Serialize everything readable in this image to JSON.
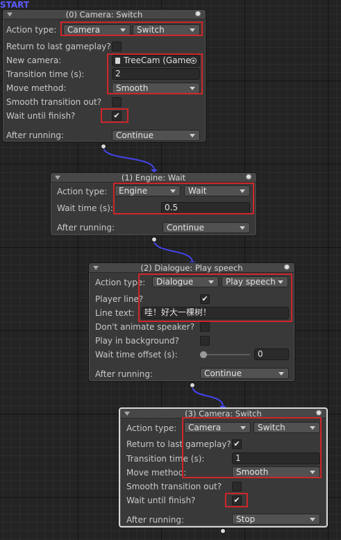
{
  "start_label": "START",
  "nodes": [
    {
      "title": "(0) Camera: Switch",
      "action_type_label": "Action type:",
      "category": "Camera",
      "action": "Switch",
      "return_label": "Return to last gameplay?",
      "return_checked": false,
      "new_camera_label": "New camera:",
      "new_camera_value": "TreeCam (Game",
      "transition_label": "Transition time (s):",
      "transition_value": "2",
      "move_method_label": "Move method:",
      "move_method_value": "Smooth",
      "smooth_out_label": "Smooth transition out?",
      "smooth_out_checked": false,
      "wait_finish_label": "Wait until finish?",
      "wait_finish_checked": true,
      "after_running_label": "After running:",
      "after_running_value": "Continue"
    },
    {
      "title": "(1) Engine: Wait",
      "action_type_label": "Action type:",
      "category": "Engine",
      "action": "Wait",
      "wait_time_label": "Wait time (s):",
      "wait_time_value": "0.5",
      "after_running_label": "After running:",
      "after_running_value": "Continue"
    },
    {
      "title": "(2) Dialogue: Play speech",
      "action_type_label": "Action type:",
      "category": "Dialogue",
      "action": "Play speech",
      "player_line_label": "Player line?",
      "player_line_checked": true,
      "line_text_label": "Line text:",
      "line_text_value": "哇！好大一棵树！",
      "dont_animate_label": "Don't animate speaker?",
      "dont_animate_checked": false,
      "play_bg_label": "Play in background?",
      "play_bg_checked": false,
      "wait_offset_label": "Wait time offset (s):",
      "wait_offset_value": "0",
      "after_running_label": "After running:",
      "after_running_value": "Continue"
    },
    {
      "title": "(3) Camera: Switch",
      "action_type_label": "Action type:",
      "category": "Camera",
      "action": "Switch",
      "return_label": "Return to last gameplay?",
      "return_checked": true,
      "transition_label": "Transition time (s):",
      "transition_value": "1",
      "move_method_label": "Move method:",
      "move_method_value": "Smooth",
      "smooth_out_label": "Smooth transition out?",
      "smooth_out_checked": false,
      "wait_finish_label": "Wait until finish?",
      "wait_finish_checked": true,
      "after_running_label": "After running:",
      "after_running_value": "Stop"
    }
  ],
  "colors": {
    "start": "#5a5bff",
    "wire": "#4444ee",
    "highlight": "#d0262b",
    "canvas": "#232323",
    "node": "#393939"
  },
  "icons": [
    "gear-icon",
    "fold-arrow-icon",
    "checkmark-icon",
    "object-picker-icon",
    "script-file-icon"
  ]
}
